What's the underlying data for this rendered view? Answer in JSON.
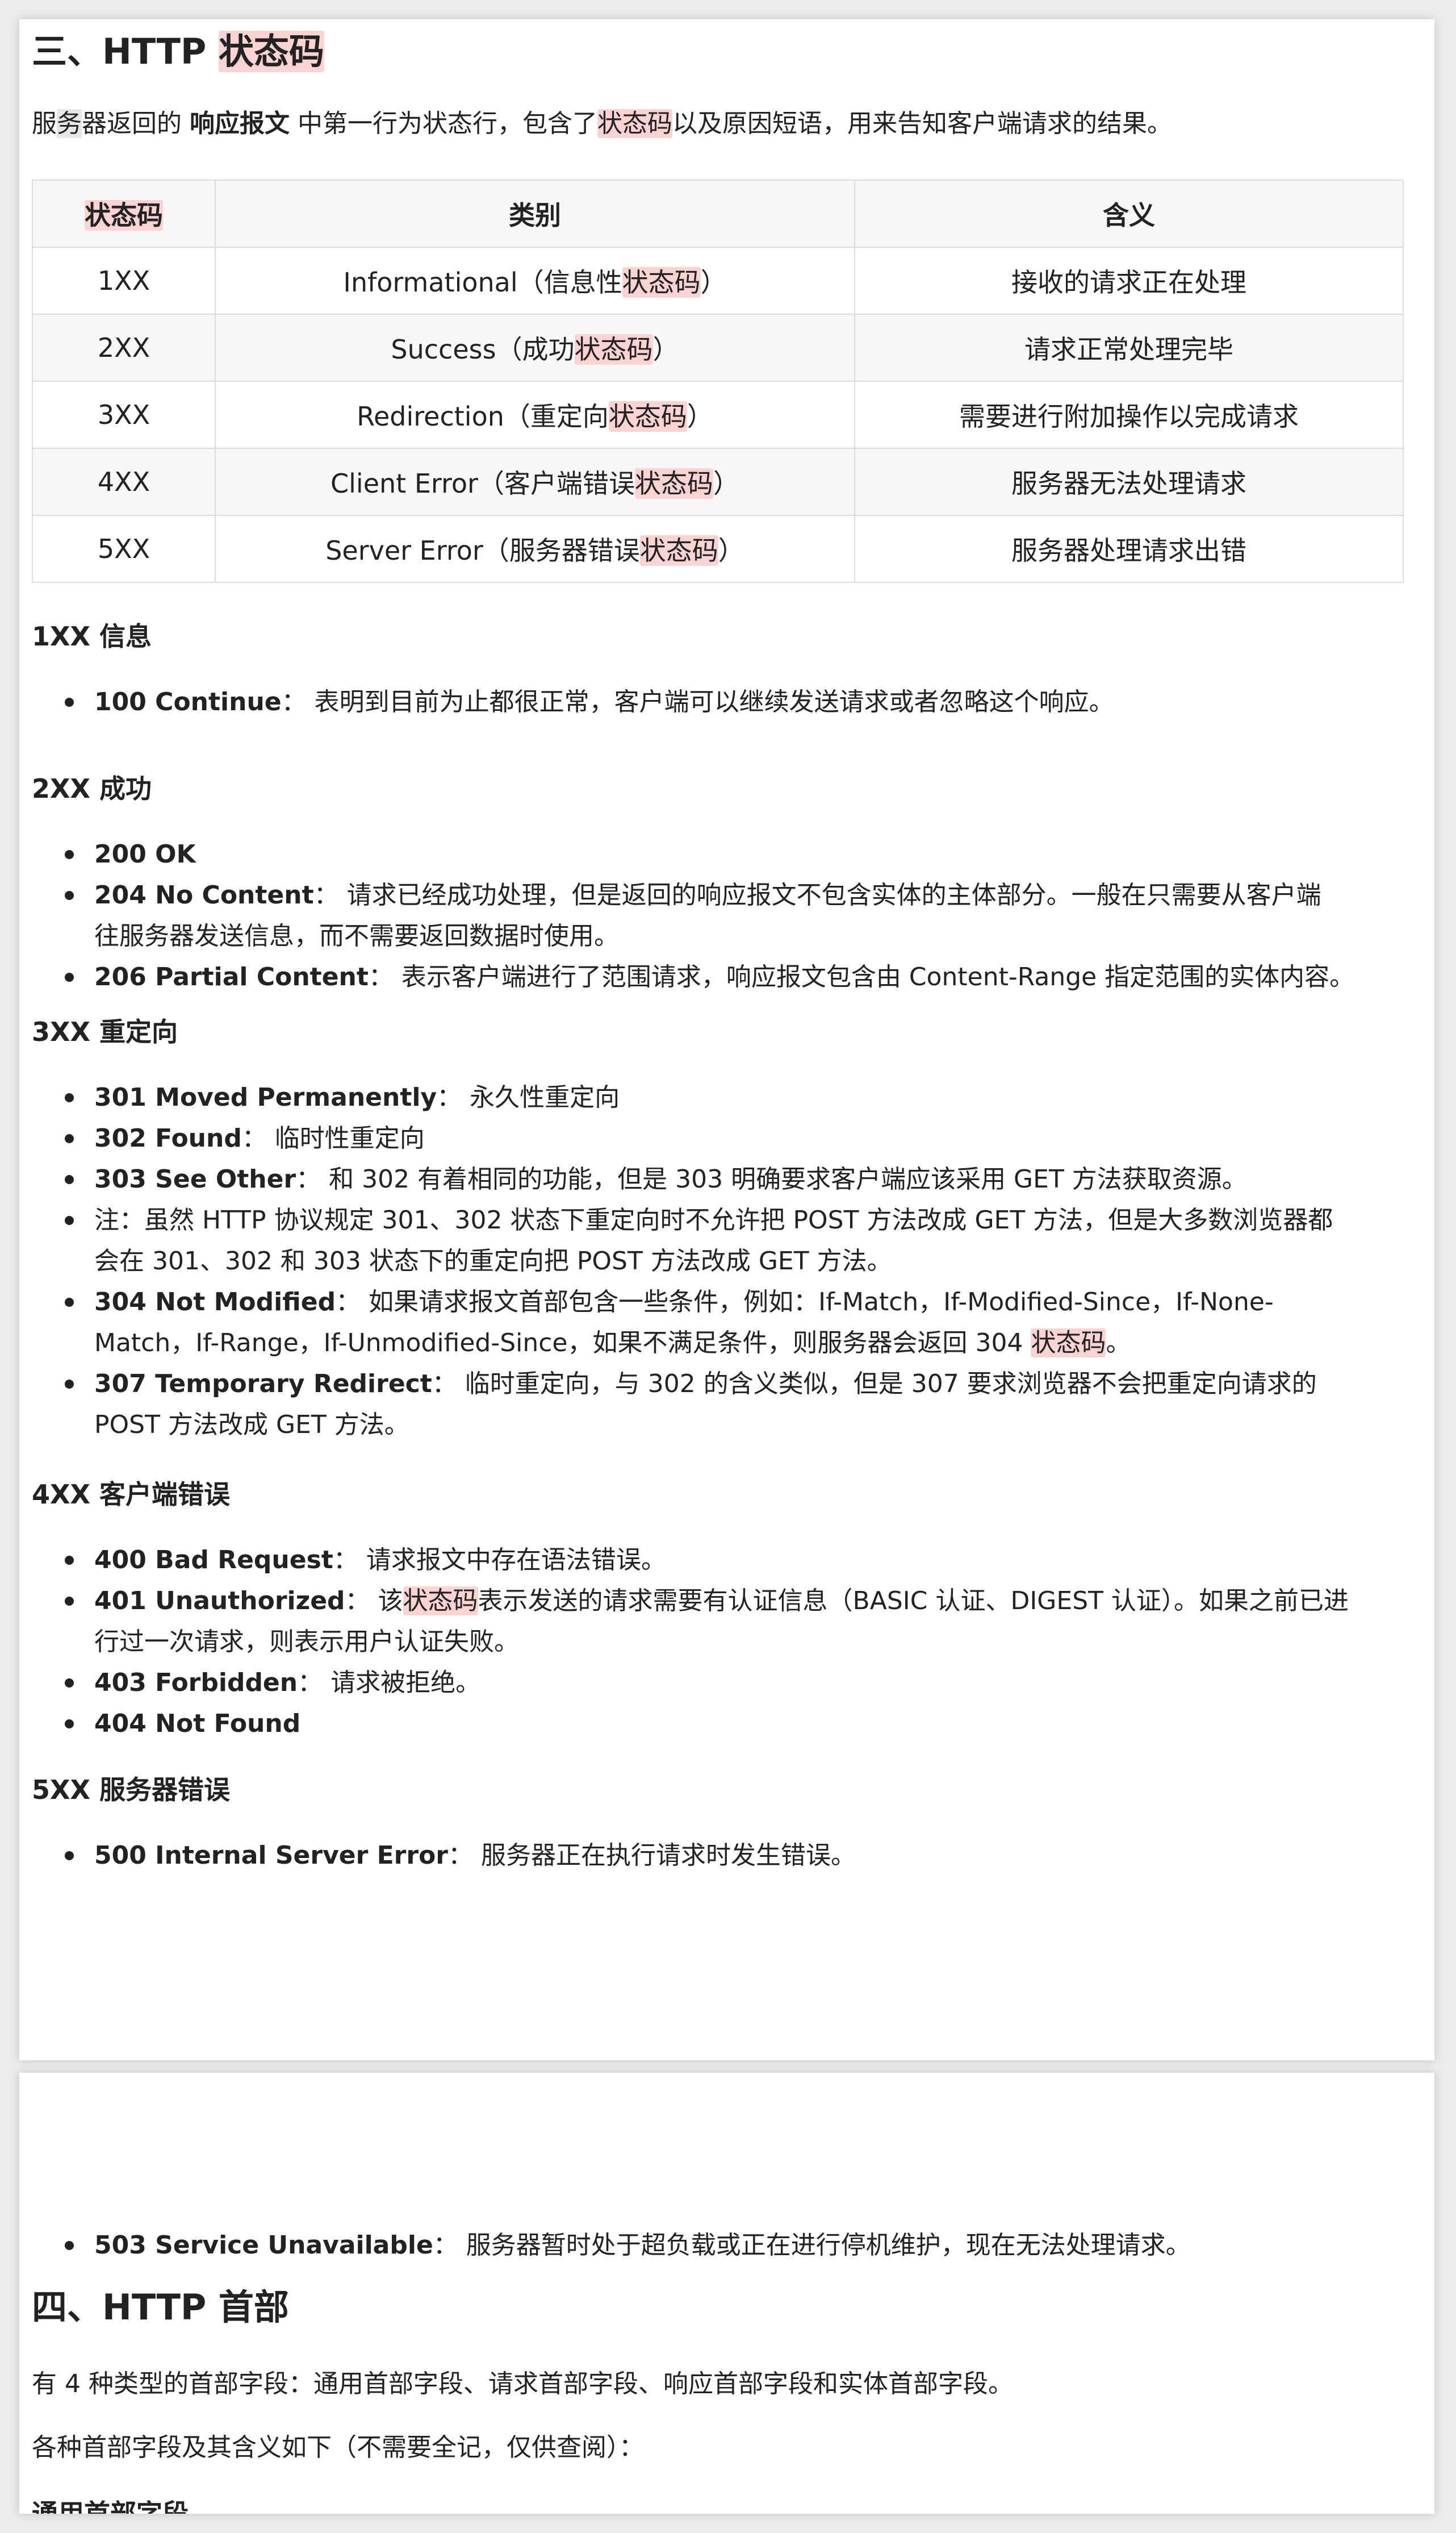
{
  "section3": {
    "title_prefix": "三、HTTP ",
    "title_hl": "状态码",
    "intro": {
      "a": "服",
      "b": "务",
      "c": "器返回的 ",
      "bold": "响应报文",
      "d": " 中第一行为状态行，包含了",
      "hl": "状态码",
      "e": "以及原因短语，用来告知客户端请求的结果。"
    },
    "table": {
      "headers": {
        "code": "状态码",
        "category": "类别",
        "meaning": "含义"
      },
      "rows": [
        {
          "code": "1XX",
          "cat_pre": "Informational（信息性",
          "cat_hl": "状态码",
          "cat_post": "）",
          "meaning": "接收的请求正在处理"
        },
        {
          "code": "2XX",
          "cat_pre": "Success（成功",
          "cat_hl": "状态码",
          "cat_post": "）",
          "meaning": "请求正常处理完毕"
        },
        {
          "code": "3XX",
          "cat_pre": "Redirection（重定向",
          "cat_hl": "状态码",
          "cat_post": "）",
          "meaning": "需要进行附加操作以完成请求"
        },
        {
          "code": "4XX",
          "cat_pre": "Client Error（客户端错误",
          "cat_hl": "状态码",
          "cat_post": "）",
          "meaning": "服务器无法处理请求"
        },
        {
          "code": "5XX",
          "cat_pre": "Server Error（服务器错误",
          "cat_hl": "状态码",
          "cat_post": "）",
          "meaning": "服务器处理请求出错"
        }
      ]
    },
    "s1xx": {
      "heading": "1XX 信息",
      "i100": {
        "b": "100 Continue",
        "t": "： 表明到目前为止都很正常，客户端可以继续发送请求或者忽略这个响应。"
      }
    },
    "s2xx": {
      "heading": "2XX 成功",
      "i200": {
        "b": "200 OK"
      },
      "i204": {
        "b": "204 No Content",
        "t1": "： 请求已经成功处理，但是返回的响应报文不包含实体的主体部分。一般在只需要从客户端",
        "t2": "往服务器发送信息，而不需要返回数据时使用。"
      },
      "i206": {
        "b": "206 Partial Content",
        "t": "： 表示客户端进行了范围请求，响应报文包含由 Content-Range 指定范围的实体内容。"
      }
    },
    "s3xx": {
      "heading": "3XX 重定向",
      "i301": {
        "b": "301 Moved Permanently",
        "t": "： 永久性重定向"
      },
      "i302": {
        "b": "302 Found",
        "t": "： 临时性重定向"
      },
      "i303": {
        "b": "303 See Other",
        "t": "： 和 302 有着相同的功能，但是 303 明确要求客户端应该采用 GET 方法获取资源。"
      },
      "note": {
        "t1": "注：虽然 HTTP 协议规定 301、302 状态下重定向时不允许把 POST 方法改成 GET 方法，但是大多数浏览器都",
        "t2": "会在 301、302 和 303 状态下的重定向把 POST 方法改成 GET 方法。"
      },
      "i304": {
        "b": "304 Not Modified",
        "t1": "： 如果请求报文首部包含一些条件，例如：If-Match，If-Modified-Since，If-None-",
        "t2": "Match，If-Range，If-Unmodified-Since，如果不满足条件，则服务器会返回 304 ",
        "hl": "状态码",
        "t3": "。"
      },
      "i307": {
        "b": "307 Temporary Redirect",
        "t1": "： 临时重定向，与 302 的含义类似，但是 307 要求浏览器不会把重定向请求的",
        "t2": "POST 方法改成 GET 方法。"
      }
    },
    "s4xx": {
      "heading": "4XX 客户端错误",
      "i400": {
        "b": "400 Bad Request",
        "t": "： 请求报文中存在语法错误。"
      },
      "i401": {
        "b": "401 Unauthorized",
        "t1": "： 该",
        "hl": "状态码",
        "t2": "表示发送的请求需要有认证信息（BASIC 认证、DIGEST 认证）。如果之前已进",
        "t3": "行过一次请求，则表示用户认证失败。"
      },
      "i403": {
        "b": "403 Forbidden",
        "t": "： 请求被拒绝。"
      },
      "i404": {
        "b": "404 Not Found"
      }
    },
    "s5xx": {
      "heading": "5XX 服务器错误",
      "i500": {
        "b": "500 Internal Server Error",
        "t": "： 服务器正在执行请求时发生错误。"
      },
      "i503": {
        "b": "503 Service Unavailable",
        "t": "： 服务器暂时处于超负载或正在进行停机维护，现在无法处理请求。"
      }
    }
  },
  "section4": {
    "title": "四、HTTP 首部",
    "p1": "有 4 种类型的首部字段：通用首部字段、请求首部字段、响应首部字段和实体首部字段。",
    "p2": "各种首部字段及其含义如下（不需要全记，仅供查阅）：",
    "cut_heading": "通用首部字段"
  }
}
